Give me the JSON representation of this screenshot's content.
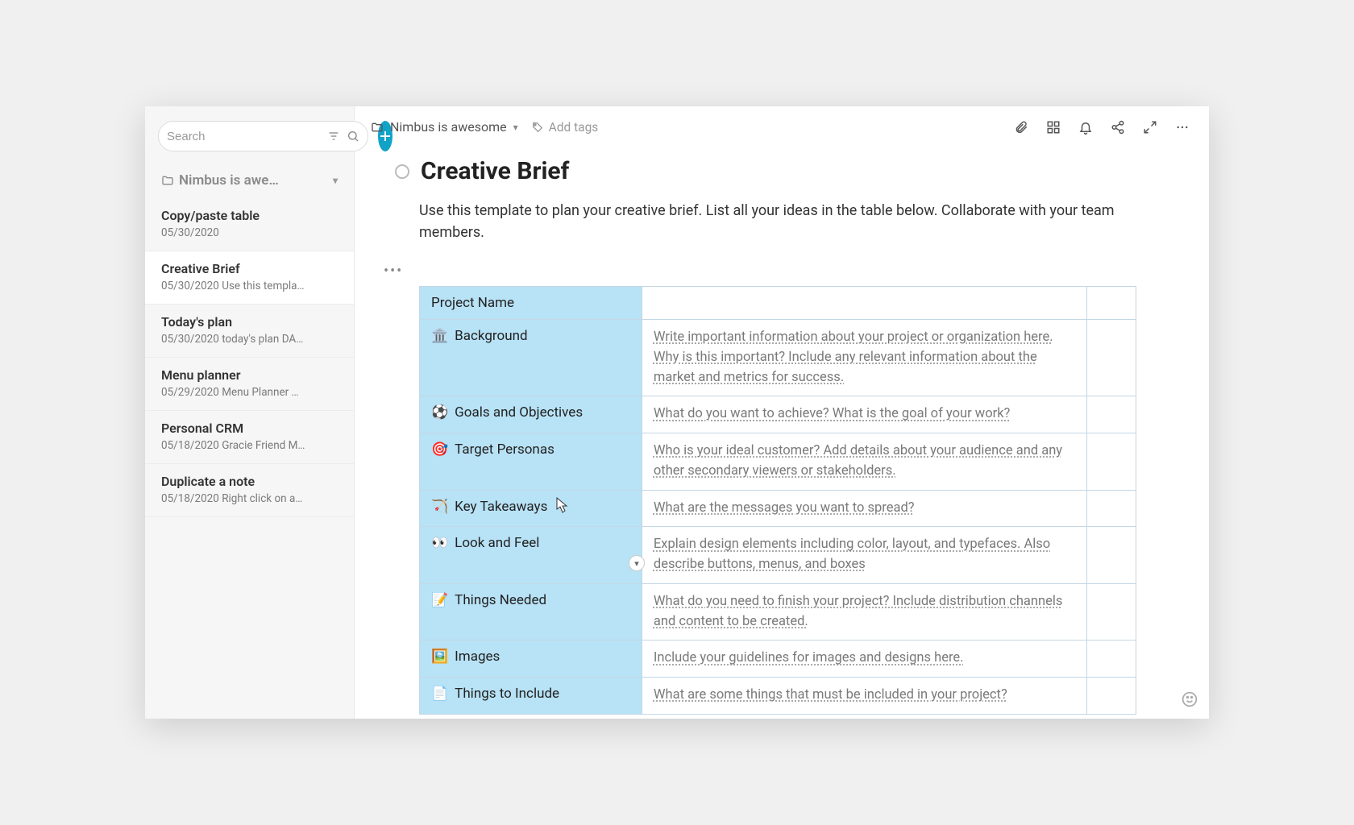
{
  "search": {
    "placeholder": "Search"
  },
  "folder": {
    "name": "Nimbus is awe…"
  },
  "notes": [
    {
      "title": "Copy/paste table",
      "date": "05/30/2020",
      "preview": ""
    },
    {
      "title": "Creative Brief",
      "date": "05/30/2020",
      "preview": "Use this templa…"
    },
    {
      "title": "Today's plan",
      "date": "05/30/2020",
      "preview": "today's plan DA…"
    },
    {
      "title": "Menu planner",
      "date": "05/29/2020",
      "preview": "Menu Planner …"
    },
    {
      "title": "Personal CRM",
      "date": "05/18/2020",
      "preview": "Gracie Friend M…"
    },
    {
      "title": "Duplicate a note",
      "date": "05/18/2020",
      "preview": "Right click on a…"
    }
  ],
  "breadcrumb": {
    "label": "Nimbus is awesome"
  },
  "tags": {
    "add_label": "Add tags"
  },
  "doc": {
    "title": "Creative Brief",
    "description": "Use this template to plan your creative brief. List all your ideas in the table below. Collaborate with your team members."
  },
  "table": {
    "header": "Project Name",
    "rows": [
      {
        "icon": "🏛️",
        "label": "Background",
        "value": "Write important information about your project or organization here. Why is this important? Include any relevant information about the market and metrics for success."
      },
      {
        "icon": "⚽",
        "label": "Goals and Objectives",
        "value": "What do you want to achieve? What is the goal of your work?"
      },
      {
        "icon": "🎯",
        "label": "Target Personas",
        "value": "Who is your ideal customer? Add details about your audience and any other secondary viewers or stakeholders."
      },
      {
        "icon": "🏹",
        "label": "Key Takeaways",
        "value": "What are the messages you want to spread?"
      },
      {
        "icon": "👀",
        "label": "Look and Feel",
        "value": "Explain design elements including color, layout, and typefaces. Also describe buttons, menus, and boxes"
      },
      {
        "icon": "📝",
        "label": "Things Needed",
        "value": "What do you need to finish your project? Include distribution channels and content to be created."
      },
      {
        "icon": "🖼️",
        "label": "Images",
        "value": "Include your guidelines for images and designs here."
      },
      {
        "icon": "📄",
        "label": "Things to Include",
        "value": "What are some things that must be included in your project?"
      }
    ]
  }
}
